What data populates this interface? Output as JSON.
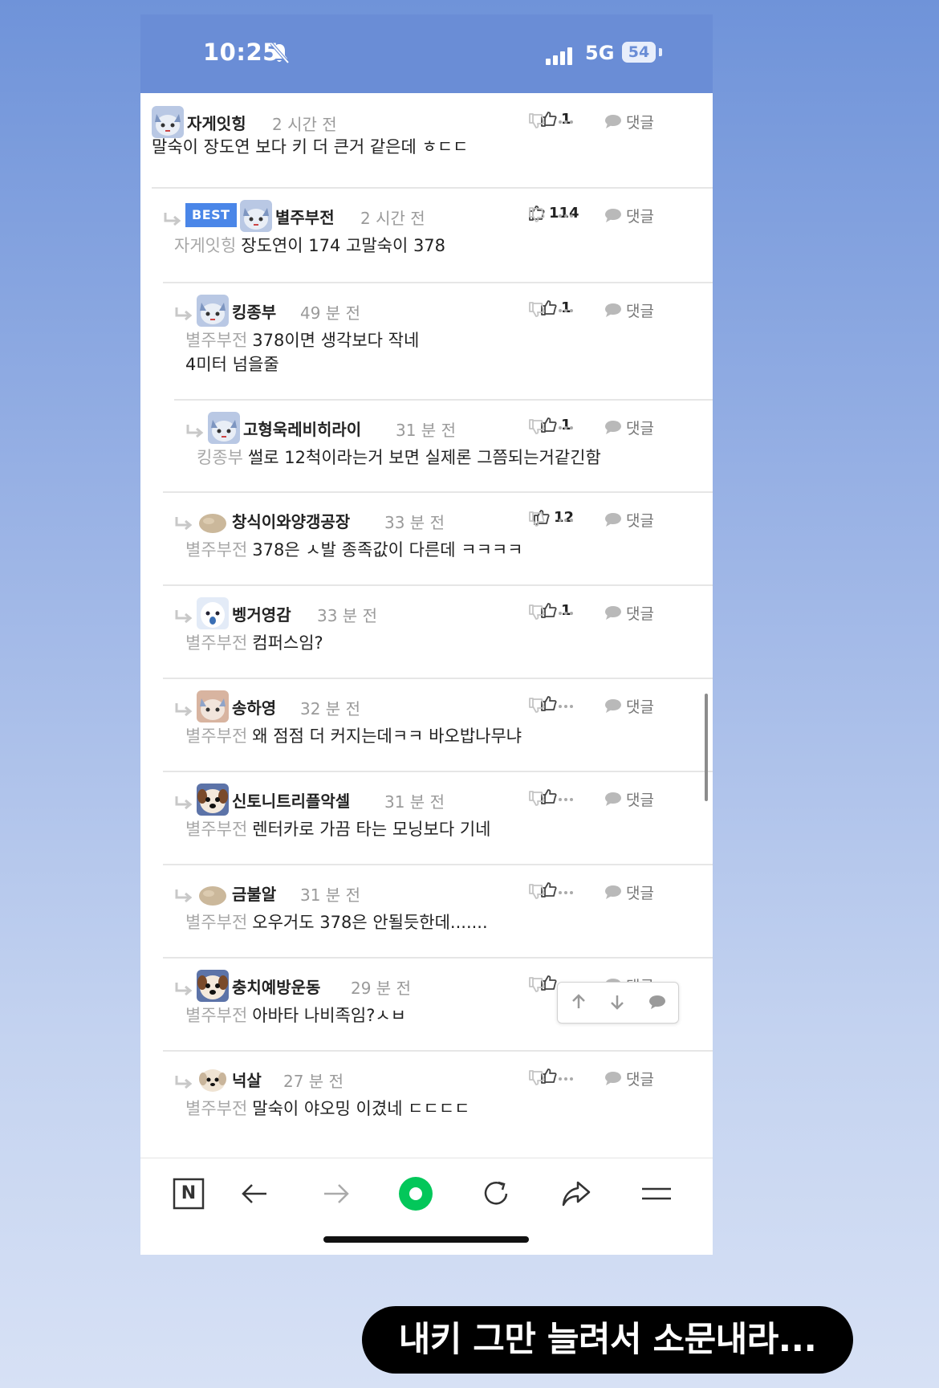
{
  "status_bar": {
    "time": "10:25",
    "network": "5G",
    "battery": "54"
  },
  "comments": [
    {
      "nickname": "자게잇힝",
      "time": "2 시간 전",
      "likes": "1",
      "reply_label": "댓글",
      "mention": "",
      "text": "말숙이 장도연 보다 키 더 큰거 같은데 ㅎㄷㄷ",
      "best": ""
    },
    {
      "nickname": "별주부전",
      "time": "2 시간 전",
      "likes": "114",
      "reply_label": "댓글",
      "mention": "자게잇힝",
      "text": "장도연이 174 고말숙이 378",
      "best": "BEST"
    },
    {
      "nickname": "킹종부",
      "time": "49 분 전",
      "likes": "1",
      "reply_label": "댓글",
      "mention": "별주부전",
      "text": "378이면 생각보다 작네",
      "text2": "4미터 넘을줄",
      "best": ""
    },
    {
      "nickname": "고형욱레비히라이",
      "time": "31 분 전",
      "likes": "1",
      "reply_label": "댓글",
      "mention": "킹종부",
      "text": "썰로 12척이라는거 보면 실제론 그쯤되는거같긴함",
      "best": ""
    },
    {
      "nickname": "창식이와양갱공장",
      "time": "33 분 전",
      "likes": "12",
      "reply_label": "댓글",
      "mention": "별주부전",
      "text": "378은 ㅅ발 종족값이 다른데 ㅋㅋㅋㅋ",
      "best": ""
    },
    {
      "nickname": "벵거영감",
      "time": "33 분 전",
      "likes": "1",
      "reply_label": "댓글",
      "mention": "별주부전",
      "text": "컴퍼스임?",
      "best": ""
    },
    {
      "nickname": "송하영",
      "time": "32 분 전",
      "likes": "",
      "reply_label": "댓글",
      "mention": "별주부전",
      "text": "왜 점점 더 커지는데ㅋㅋ 바오밥나무냐",
      "best": ""
    },
    {
      "nickname": "신토니트리플악셀",
      "time": "31 분 전",
      "likes": "",
      "reply_label": "댓글",
      "mention": "별주부전",
      "text": "렌터카로 가끔 타는 모닝보다 기네",
      "best": ""
    },
    {
      "nickname": "금불알",
      "time": "31 분 전",
      "likes": "",
      "reply_label": "댓글",
      "mention": "별주부전",
      "text": "오우거도 378은 안될듯한데.......",
      "best": ""
    },
    {
      "nickname": "충치예방운동",
      "time": "29 분 전",
      "likes": "",
      "reply_label": "댓글",
      "mention": "별주부전",
      "text": "아바타 나비족임?ㅅㅂ",
      "best": ""
    },
    {
      "nickname": "넉살",
      "time": "27 분 전",
      "likes": "",
      "reply_label": "댓글",
      "mention": "별주부전",
      "text": "말숙이 야오밍 이겼네 ㄷㄷㄷㄷ",
      "best": ""
    }
  ],
  "bottom_nav": {
    "n_label": "N"
  },
  "caption": "내키 그만 늘려서 소문내라...",
  "colors": {
    "status_bar": "#6a8dd6",
    "best_badge": "#4a86e8",
    "naver_green": "#03c75a"
  }
}
